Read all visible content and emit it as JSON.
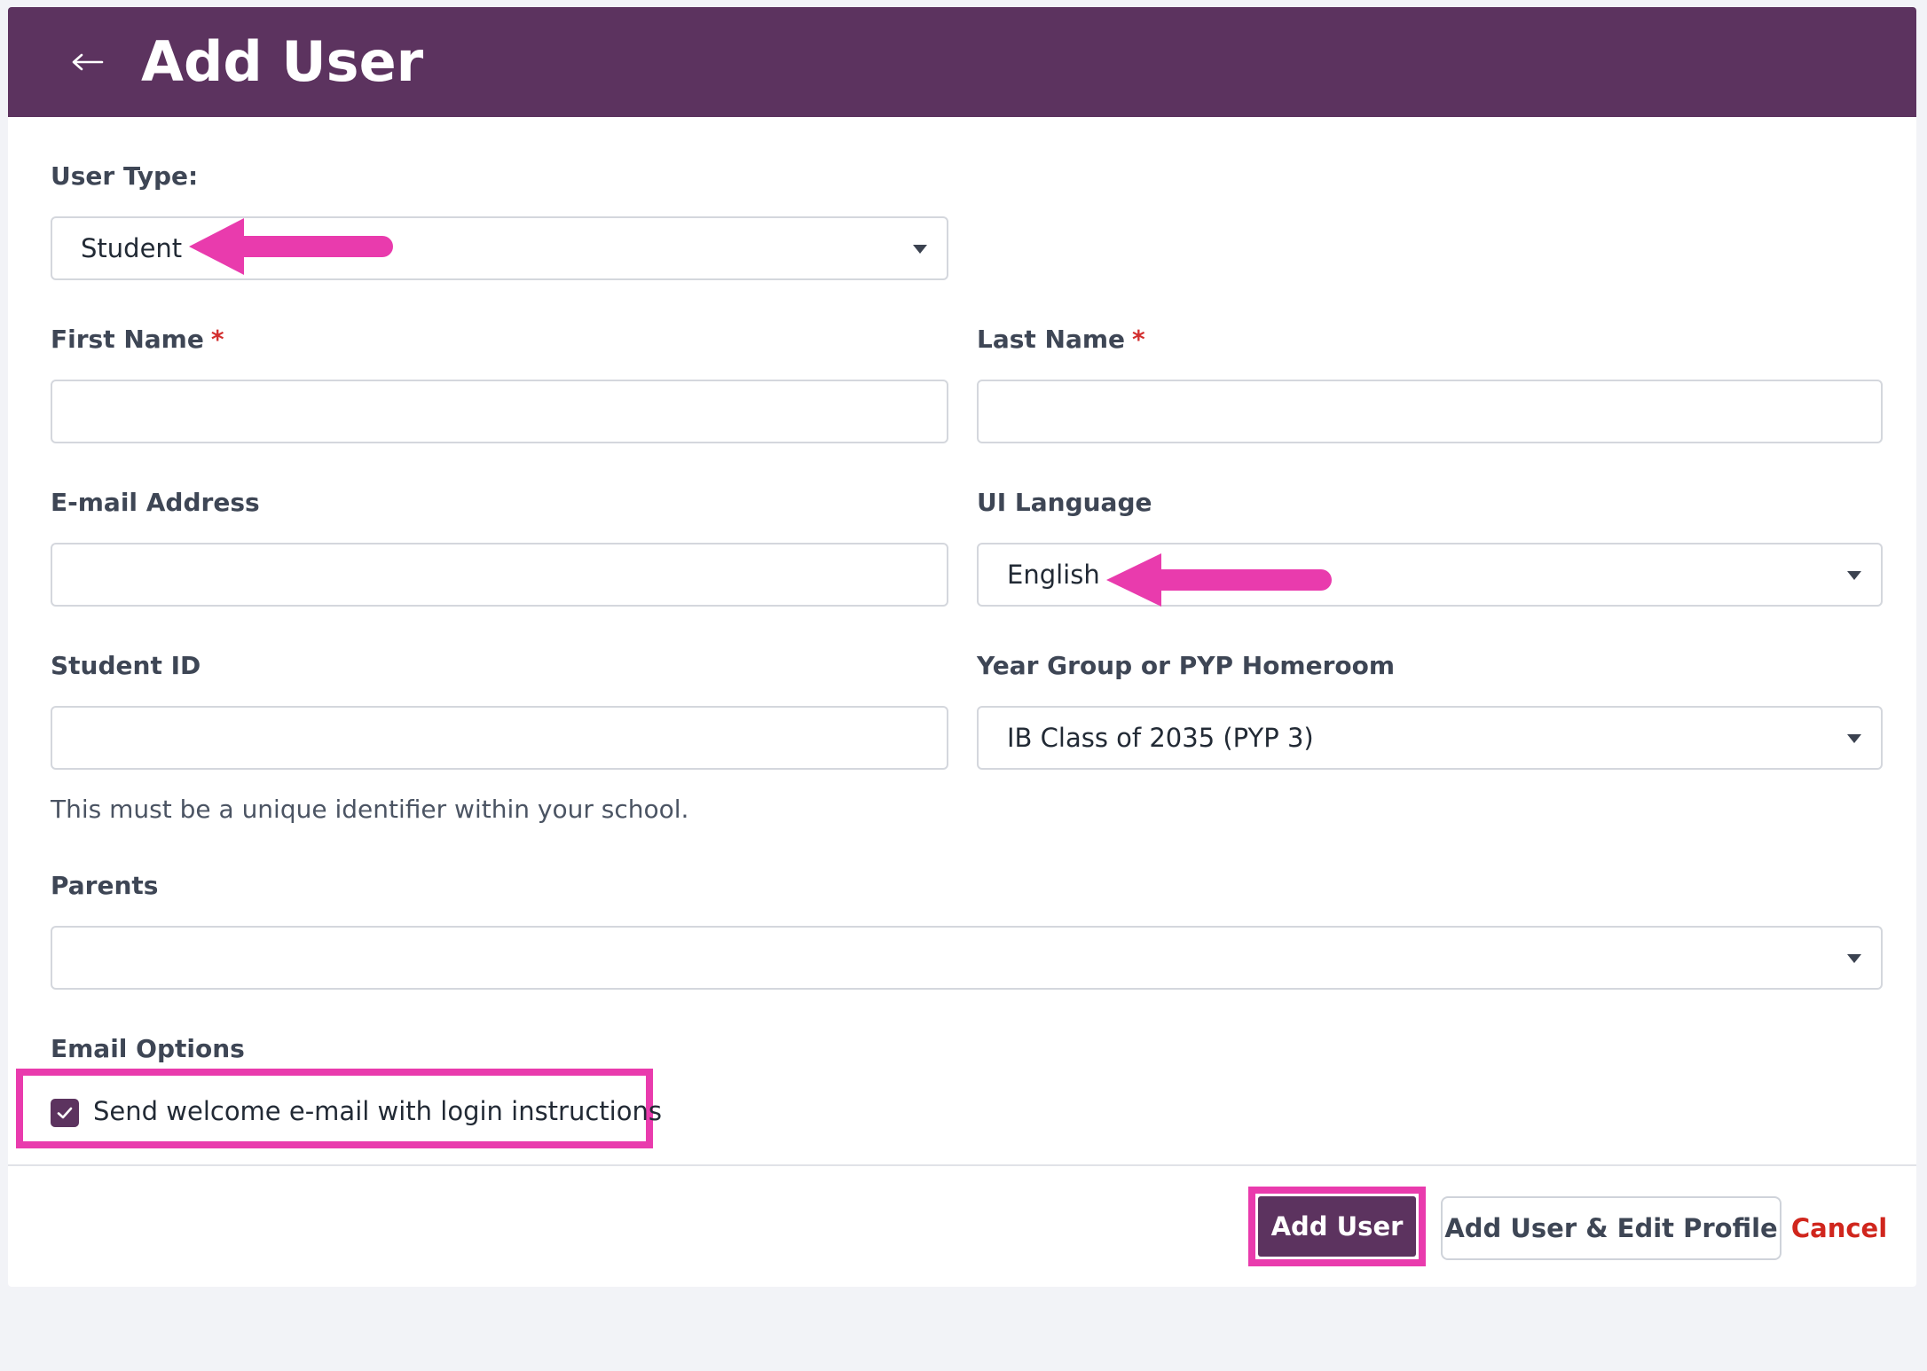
{
  "header": {
    "title": "Add User",
    "back_icon": "arrow-left-icon"
  },
  "form": {
    "user_type": {
      "label": "User Type:",
      "value": "Student"
    },
    "first_name": {
      "label": "First Name",
      "required_mark": "*",
      "value": ""
    },
    "last_name": {
      "label": "Last Name",
      "required_mark": "*",
      "value": ""
    },
    "email": {
      "label": "E-mail Address",
      "value": ""
    },
    "ui_language": {
      "label": "UI Language",
      "value": "English"
    },
    "student_id": {
      "label": "Student ID",
      "value": "",
      "helper": "This must be a unique identifier within your school."
    },
    "year_group": {
      "label": "Year Group or PYP Homeroom",
      "value": "IB Class of 2035 (PYP 3)"
    },
    "parents": {
      "label": "Parents",
      "value": ""
    },
    "email_options": {
      "label": "Email Options",
      "welcome_checkbox": {
        "label": "Send welcome e-mail with login instructions",
        "checked": true
      }
    }
  },
  "footer": {
    "add_user_label": "Add User",
    "add_edit_label": "Add User & Edit Profile",
    "cancel_label": "Cancel"
  },
  "colors": {
    "header_bg": "#5c335f",
    "primary_button": "#5c335f",
    "annotation": "#e93bad",
    "cancel_text": "#d0261d",
    "required_mark": "#d32f2f"
  }
}
